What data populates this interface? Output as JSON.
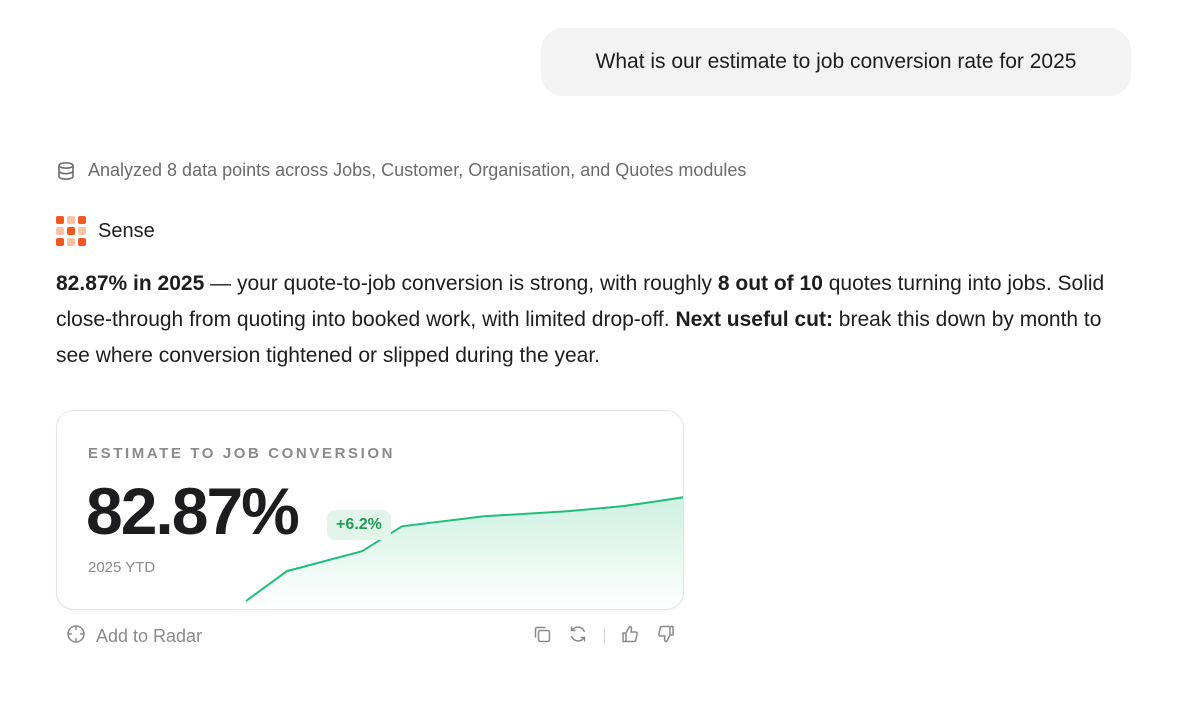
{
  "user_message": "What is our estimate to job conversion rate for 2025",
  "analysis": {
    "icon": "database-icon",
    "text": "Analyzed 8 data points across Jobs, Customer, Organisation, and Quotes modules"
  },
  "assistant": {
    "name": "Sense",
    "logo_color": "#f05a22"
  },
  "answer": {
    "headline": "82.87% in 2025",
    "part1": " — your quote-to-job conversion is strong, with roughly ",
    "highlight": "8 out of 10",
    "part2": " quotes turning into jobs. Solid close-through from quoting into booked work, with limited drop-off. ",
    "next_label": "Next useful cut:",
    "part3": " break this down by month to see where conversion tightened or slipped during the year."
  },
  "metric_card": {
    "label": "ESTIMATE TO JOB CONVERSION",
    "value": "82.87%",
    "change": "+6.2%",
    "period": "2025 YTD",
    "accent": "#1fbf7a",
    "trend": [
      62,
      68,
      72,
      77,
      79,
      80,
      81,
      82,
      82.87
    ]
  },
  "actions": {
    "add_to_radar": "Add to Radar",
    "icons": [
      "copy-icon",
      "refresh-icon",
      "thumbs-up-icon",
      "thumbs-down-icon"
    ]
  }
}
